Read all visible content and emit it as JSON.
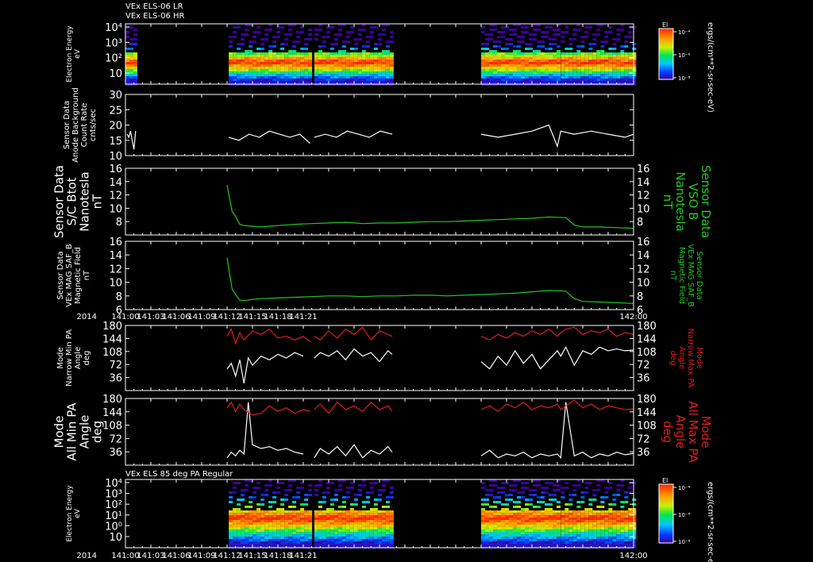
{
  "header_lines": [
    "VEx ELS-06 LR",
    "VEx ELS-06 HR"
  ],
  "x_axis": {
    "tick_labels": [
      "141:00",
      "141:03",
      "141:06",
      "141:09",
      "141:12",
      "141:15",
      "141:18",
      "141:21",
      "142:00"
    ],
    "year_label": "2014",
    "range_minutes": [
      0,
      60
    ]
  },
  "colorbar": {
    "title": "El",
    "unit_label": "ergs/(cm**2-sr-sec-eV)",
    "tick_labels": [
      "10⁻⁴",
      "10⁻⁶",
      "10⁻⁸"
    ]
  },
  "colors": {
    "white": "#ffffff",
    "green": "#22c922",
    "red": "#e01e1e",
    "axes": "#ffffff"
  },
  "chart_data": [
    {
      "id": "spec_top",
      "type": "heatmap",
      "ylabel": [
        "Electron Energy",
        "eV"
      ],
      "ytick_labels": [
        "10⁴",
        "10³",
        "10²",
        "10"
      ],
      "scale": "log",
      "coverage_minutes": [
        [
          0,
          1.2
        ],
        [
          12.2,
          21.8
        ],
        [
          22.3,
          31.5
        ],
        [
          42,
          51
        ],
        [
          51.4,
          60
        ]
      ]
    },
    {
      "id": "background",
      "type": "line",
      "ylabel": [
        "Sensor Data",
        "Anode Background",
        "Count Rate",
        "cnts/sec"
      ],
      "ylim": [
        10,
        30
      ],
      "ytick_labels": [
        "30",
        "25",
        "20",
        "15",
        "10"
      ],
      "series": [
        {
          "x": [
            0.2,
            0.4,
            0.6,
            0.8,
            1.0,
            1.2
          ],
          "y": [
            17,
            16,
            18,
            15,
            12,
            18
          ]
        },
        {
          "x": [
            12.2,
            13.4,
            14.6,
            15.8,
            17.0,
            18.2,
            19.4,
            20.6,
            21.8
          ],
          "y": [
            16,
            15,
            17,
            16,
            18,
            17,
            16,
            17,
            14
          ]
        },
        {
          "x": [
            22.3,
            23.6,
            24.9,
            26.2,
            27.5,
            28.8,
            30.1,
            31.5
          ],
          "y": [
            16,
            17,
            16,
            18,
            17,
            16,
            18,
            17
          ]
        },
        {
          "x": [
            42,
            44,
            46,
            48,
            50,
            51,
            51.4,
            53,
            55,
            57,
            59,
            60
          ],
          "y": [
            17,
            16,
            17,
            18,
            20,
            13,
            18,
            17,
            18,
            17,
            16,
            17
          ]
        }
      ]
    },
    {
      "id": "sc_bt",
      "type": "line",
      "ylabel": [
        "Sensor Data",
        "S/C Btot",
        "Nanotesla",
        "nT"
      ],
      "ylabel_right": [
        "Sensor Data",
        "VSO B",
        "Nanotesla",
        "nT"
      ],
      "ylim": [
        6,
        16
      ],
      "ytick_labels": [
        "16",
        "14",
        "12",
        "10",
        "8"
      ],
      "series": [
        {
          "x": [
            12,
            12.3,
            12.6,
            13,
            13.5,
            14,
            15,
            16,
            18,
            20,
            22,
            24,
            26,
            28,
            30,
            32,
            34,
            36,
            38,
            40,
            42,
            44,
            46,
            48,
            50,
            52,
            53,
            54,
            56,
            58,
            60
          ],
          "y": [
            13.5,
            11.5,
            9.5,
            8.8,
            7.6,
            7.4,
            7.3,
            7.2,
            7.4,
            7.6,
            7.7,
            7.8,
            7.9,
            7.7,
            7.8,
            7.8,
            7.9,
            8.0,
            8.0,
            8.1,
            8.2,
            8.3,
            8.4,
            8.5,
            8.7,
            8.6,
            7.5,
            7.2,
            7.2,
            7.1,
            7.0
          ]
        }
      ]
    },
    {
      "id": "mag_saf",
      "type": "line",
      "ylabel": [
        "Sensor Data",
        "VEx MAG SAF_B",
        "Magnetic Field",
        "nT"
      ],
      "ylabel_right": [
        "Sensor Data",
        "VEx MAG SAF_B",
        "Magnetic Field",
        "nT"
      ],
      "ylim": [
        6,
        16
      ],
      "ytick_labels": [
        "16",
        "14",
        "12",
        "10",
        "8",
        "6"
      ],
      "series": [
        {
          "x": [
            12,
            12.3,
            12.6,
            13,
            13.5,
            14,
            15,
            16,
            18,
            20,
            22,
            24,
            26,
            28,
            30,
            32,
            34,
            36,
            38,
            40,
            42,
            44,
            46,
            48,
            50,
            52,
            53,
            54,
            56,
            58,
            60
          ],
          "y": [
            13.6,
            11.2,
            9.0,
            8.2,
            7.4,
            7.3,
            7.5,
            7.6,
            7.7,
            7.8,
            7.9,
            8.0,
            8.0,
            7.9,
            8.0,
            8.0,
            8.1,
            8.1,
            8.0,
            8.1,
            8.2,
            8.3,
            8.4,
            8.6,
            8.8,
            8.7,
            7.6,
            7.2,
            7.1,
            7.0,
            6.9
          ]
        }
      ]
    },
    {
      "id": "narrow_pa",
      "type": "line",
      "ylabel": [
        "Mode",
        "Narrow Min PA",
        "Angle",
        "deg"
      ],
      "ylabel_right": [
        "Mode",
        "Narrow Max PA",
        "Angle",
        "deg"
      ],
      "ylim": [
        0,
        180
      ],
      "ytick_labels": [
        "180",
        "144",
        "108",
        "72",
        "36"
      ],
      "series": [
        {
          "color": "white",
          "x": [
            12,
            12.5,
            13,
            13.5,
            14,
            14.5,
            15,
            16,
            17,
            18,
            19,
            20,
            21
          ],
          "y": [
            60,
            75,
            40,
            85,
            20,
            90,
            70,
            95,
            85,
            100,
            90,
            105,
            95
          ]
        },
        {
          "color": "red",
          "x": [
            12,
            12.5,
            13,
            13.5,
            14,
            15,
            16,
            17,
            18,
            19,
            20,
            21,
            21.8
          ],
          "y": [
            150,
            170,
            130,
            160,
            140,
            165,
            155,
            170,
            145,
            150,
            140,
            150,
            135
          ]
        },
        {
          "color": "white",
          "x": [
            22.3,
            23,
            24,
            25,
            26,
            27,
            28,
            29,
            30,
            31,
            31.5
          ],
          "y": [
            90,
            105,
            95,
            110,
            85,
            115,
            95,
            105,
            80,
            110,
            100
          ]
        },
        {
          "color": "red",
          "x": [
            22.3,
            23,
            24,
            25,
            26,
            27,
            28,
            29,
            30,
            31,
            31.5
          ],
          "y": [
            150,
            140,
            165,
            145,
            170,
            155,
            175,
            140,
            165,
            155,
            150
          ]
        },
        {
          "color": "white",
          "x": [
            42,
            43,
            44,
            45,
            46,
            47,
            48,
            49,
            50,
            51,
            51.4,
            52,
            53,
            54,
            55,
            56,
            57,
            58,
            59,
            60
          ],
          "y": [
            80,
            60,
            95,
            70,
            110,
            75,
            100,
            60,
            85,
            110,
            95,
            120,
            70,
            110,
            100,
            120,
            110,
            115,
            110,
            112
          ]
        },
        {
          "color": "red",
          "x": [
            42,
            43,
            44,
            45,
            46,
            47,
            48,
            49,
            50,
            51,
            51.4,
            52,
            53,
            54,
            55,
            56,
            57,
            58,
            59,
            60
          ],
          "y": [
            150,
            140,
            155,
            145,
            160,
            150,
            165,
            155,
            170,
            150,
            160,
            170,
            175,
            155,
            165,
            160,
            170,
            150,
            160,
            155
          ]
        }
      ]
    },
    {
      "id": "all_pa",
      "type": "line",
      "ylabel": [
        "Mode",
        "All Min PA",
        "Angle",
        "deg"
      ],
      "ylabel_right": [
        "Mode",
        "All Max PA",
        "Angle",
        "deg"
      ],
      "ylim": [
        0,
        180
      ],
      "ytick_labels": [
        "180",
        "144",
        "108",
        "72",
        "36"
      ],
      "series": [
        {
          "color": "white",
          "x": [
            12,
            12.5,
            13,
            13.5,
            14,
            14.5,
            15,
            16,
            17,
            18,
            19,
            20,
            21
          ],
          "y": [
            20,
            35,
            25,
            40,
            30,
            170,
            55,
            45,
            50,
            40,
            45,
            35,
            30
          ]
        },
        {
          "color": "red",
          "x": [
            12,
            12.5,
            13,
            13.5,
            14,
            15,
            16,
            17,
            18,
            19,
            20,
            21,
            21.8
          ],
          "y": [
            155,
            170,
            145,
            165,
            150,
            135,
            140,
            160,
            145,
            155,
            140,
            150,
            145
          ]
        },
        {
          "color": "white",
          "x": [
            22.3,
            23,
            24,
            25,
            26,
            27,
            28,
            29,
            30,
            31,
            31.5
          ],
          "y": [
            20,
            45,
            30,
            50,
            25,
            55,
            20,
            40,
            30,
            50,
            35
          ]
        },
        {
          "color": "red",
          "x": [
            22.3,
            23,
            24,
            25,
            26,
            27,
            28,
            29,
            30,
            31,
            31.5
          ],
          "y": [
            150,
            165,
            140,
            170,
            150,
            160,
            145,
            170,
            150,
            160,
            145
          ]
        },
        {
          "color": "white",
          "x": [
            42,
            43,
            44,
            45,
            46,
            47,
            48,
            49,
            50,
            51,
            51.4,
            52,
            53,
            54,
            55,
            56,
            57,
            58,
            59,
            60
          ],
          "y": [
            25,
            40,
            20,
            30,
            25,
            35,
            20,
            30,
            25,
            30,
            20,
            170,
            25,
            35,
            20,
            30,
            25,
            35,
            28,
            32
          ]
        },
        {
          "color": "red",
          "x": [
            42,
            43,
            44,
            45,
            46,
            47,
            48,
            49,
            50,
            51,
            51.4,
            52,
            53,
            54,
            55,
            56,
            57,
            58,
            59,
            60
          ],
          "y": [
            150,
            160,
            145,
            165,
            155,
            170,
            150,
            160,
            155,
            165,
            150,
            160,
            175,
            155,
            165,
            150,
            160,
            155,
            150,
            152
          ]
        }
      ]
    },
    {
      "id": "spec_bottom",
      "type": "heatmap",
      "title": "VEx ELS 85 deg PA Regular",
      "ylabel": [
        "Electron Energy",
        "eV"
      ],
      "ytick_labels": [
        "10⁴",
        "10³",
        "10²",
        "10¹",
        "10⁰",
        "10"
      ],
      "scale": "log",
      "coverage_minutes": [
        [
          12.2,
          21.8
        ],
        [
          22.3,
          31.5
        ],
        [
          42,
          51
        ],
        [
          51.4,
          60
        ]
      ]
    }
  ]
}
